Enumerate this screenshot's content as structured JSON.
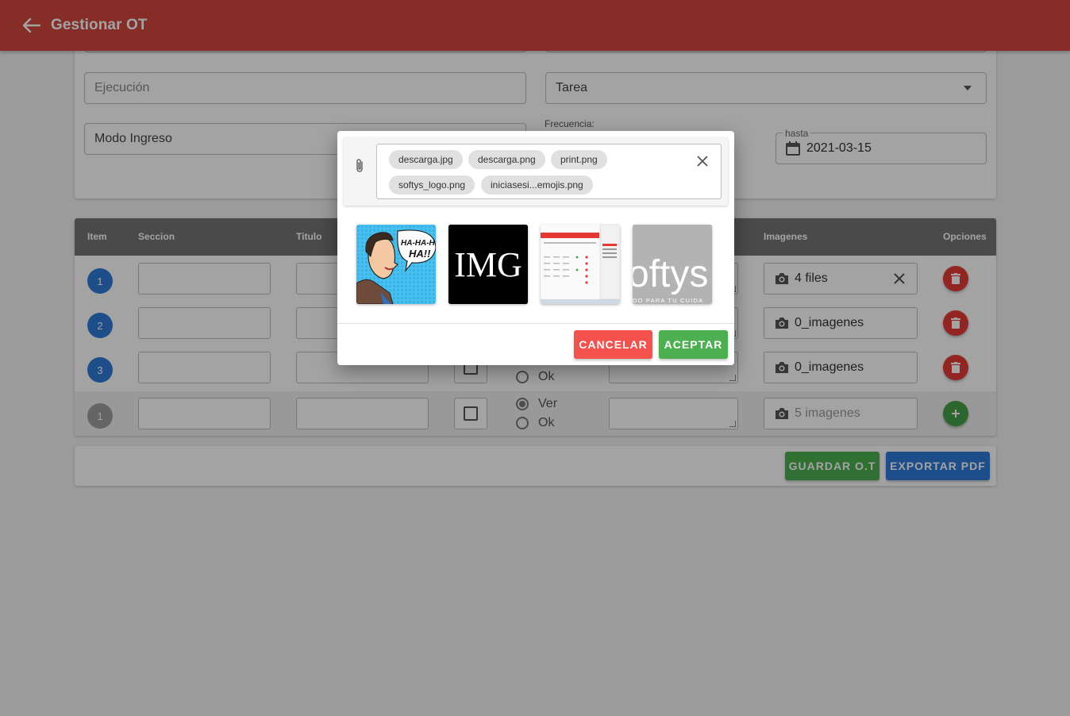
{
  "appbar": {
    "title": "Gestionar OT",
    "back_icon": "arrow-left-icon",
    "color": "#d2473f"
  },
  "form": {
    "ejecucion_placeholder": "Ejecución",
    "tarea_placeholder": "Tarea",
    "modo_ingreso_placeholder": "Modo Ingreso",
    "frecuencia_label": "Frecuencia:",
    "hasta_label": "hasta",
    "hasta_value": "2021-03-15"
  },
  "table": {
    "headers": [
      "Item",
      "Seccion",
      "Titulo",
      "Imagenes",
      "Opciones"
    ],
    "rows": [
      {
        "item": "1",
        "images": "4 files",
        "has_clear": true
      },
      {
        "item": "2",
        "images": "0_imagenes"
      },
      {
        "item": "3",
        "images": "0_imagenes",
        "radio_ok": "Ok"
      },
      {
        "item": "1",
        "images": "5 imagenes",
        "radio_ver": "Ver",
        "radio_ok": "Ok"
      }
    ]
  },
  "actions": {
    "guardar": "GUARDAR O.T",
    "exportar": "EXPORTAR PDF"
  },
  "dialog": {
    "files": [
      "descarga.jpg",
      "descarga.png",
      "print.png",
      "softys_logo.png",
      "iniciasesi...emojis.png"
    ],
    "thumbnails": [
      {
        "name": "comic-thumbnail",
        "text": "HA-HA-HA HA!!"
      },
      {
        "name": "img-logo-thumbnail",
        "text": "IMG"
      },
      {
        "name": "screenshot-thumbnail"
      },
      {
        "name": "softys-logo-thumbnail",
        "text": "oftys",
        "subtext": "DO PARA TU CUIDA"
      }
    ],
    "cancel": "CANCELAR",
    "accept": "ACEPTAR"
  },
  "colors": {
    "red": "#f5514d",
    "green": "#4caf50",
    "blue": "#2f7ad8"
  }
}
